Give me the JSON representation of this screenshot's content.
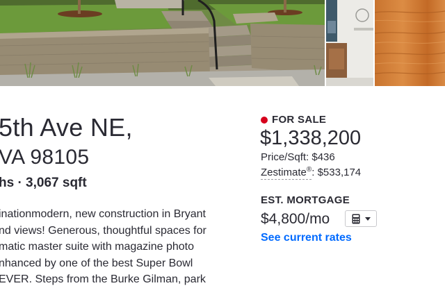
{
  "photos": {
    "main": {
      "icon": "yard-photo",
      "description_icon": "retaining-wall-stairs-image"
    },
    "side": {
      "icon": "interior-photo"
    },
    "third": {
      "icon": "wood-panel-photo"
    }
  },
  "listing": {
    "address_line1": "5th Ave NE,",
    "address_line2": "A 98105",
    "address_line2_prefix": "V",
    "beds_baths_sqft": "hs · 3,067 sqft",
    "description_lines": [
      "inationmodern, new construction in Bryant",
      "nd views! Generous, thoughtful spaces for",
      "matic master suite with magazine photo",
      "nhanced by one of the best Super Bowl",
      "EVER. Steps from the Burke Gilman, park"
    ]
  },
  "status": {
    "label": "FOR SALE",
    "dot_color": "#d6001c"
  },
  "price": {
    "value": "$1,338,200",
    "price_per_sqft": "Price/Sqft: $436",
    "zestimate_label": "Zestimate",
    "zestimate_reg": "®",
    "zestimate_value": ": $533,174"
  },
  "mortgage": {
    "title": "EST. MORTGAGE",
    "value": "$4,800/mo",
    "calculator_icon": "calculator-icon",
    "dropdown_icon": "caret-down-icon",
    "rates_link": "See current rates",
    "link_color": "#006aff"
  }
}
